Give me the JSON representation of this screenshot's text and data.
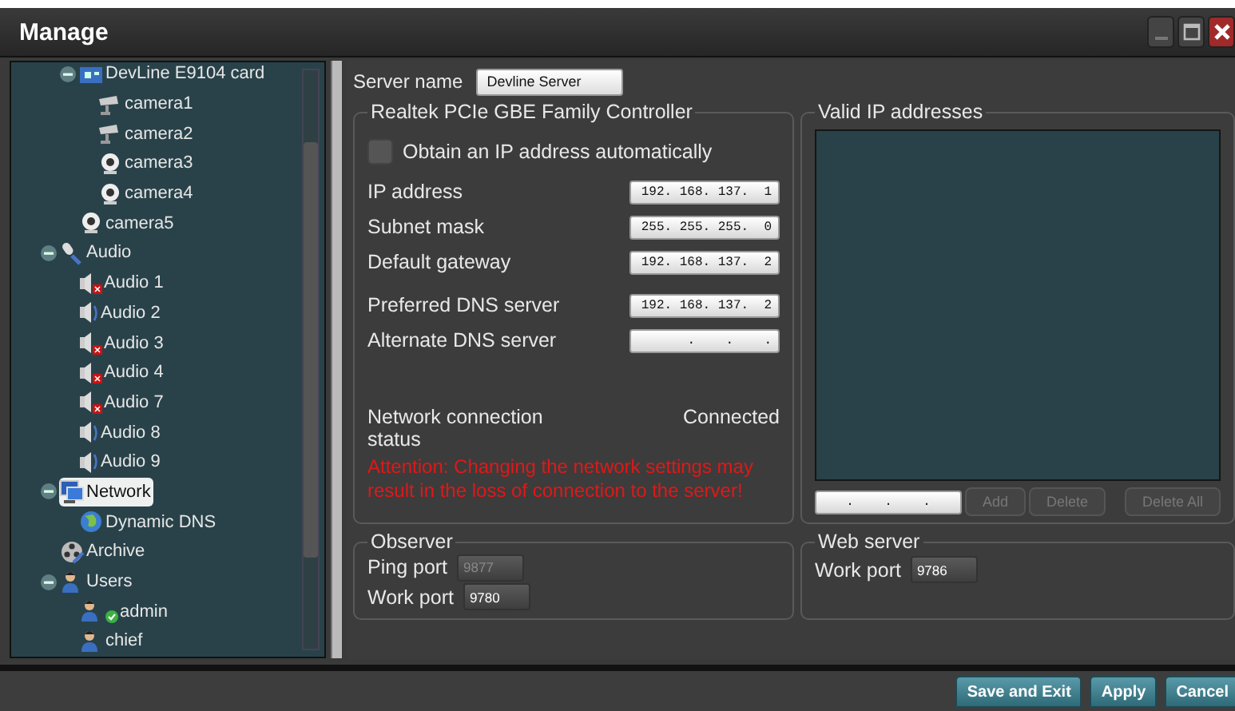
{
  "window": {
    "title": "Manage"
  },
  "tree": {
    "items": [
      {
        "children": [
          {
            "label": "DevLine E9104 card",
            "kind": "card",
            "expanded": true,
            "selected": false,
            "children": [
              {
                "label": "camera1",
                "kind": "cctv",
                "selected": false
              },
              {
                "label": "camera2",
                "kind": "cctv",
                "selected": false
              },
              {
                "label": "camera3",
                "kind": "webcam",
                "selected": false
              },
              {
                "label": "camera4",
                "kind": "webcam",
                "selected": false
              }
            ]
          },
          {
            "label": "camera5",
            "kind": "webcam",
            "selected": false
          }
        ]
      },
      {
        "label": "Audio",
        "kind": "microphone",
        "expanded": true,
        "selected": false,
        "children": [
          {
            "label": "Audio 1",
            "kind": "speaker",
            "error": true,
            "selected": false
          },
          {
            "label": "Audio 2",
            "kind": "speaker",
            "error": false,
            "selected": false
          },
          {
            "label": "Audio 3",
            "kind": "speaker",
            "error": true,
            "selected": false
          },
          {
            "label": "Audio 4",
            "kind": "speaker",
            "error": true,
            "selected": false
          },
          {
            "label": "Audio 7",
            "kind": "speaker",
            "error": true,
            "selected": false
          },
          {
            "label": "Audio 8",
            "kind": "speaker",
            "error": false,
            "selected": false
          },
          {
            "label": "Audio 9",
            "kind": "speaker",
            "error": false,
            "selected": false
          }
        ]
      },
      {
        "label": "Network",
        "kind": "network",
        "expanded": true,
        "selected": true,
        "children": [
          {
            "label": "Dynamic DNS",
            "kind": "globe",
            "selected": false
          }
        ]
      },
      {
        "label": "Archive",
        "kind": "archive",
        "selected": false
      },
      {
        "label": "Users",
        "kind": "users",
        "expanded": true,
        "selected": false,
        "children": [
          {
            "label": "admin",
            "kind": "user",
            "online": true,
            "selected": false
          },
          {
            "label": "chief",
            "kind": "user",
            "selected": false
          }
        ]
      }
    ]
  },
  "server_name": {
    "label": "Server name",
    "value": "Devline Server"
  },
  "adapter": {
    "title": "Realtek PCIe GBE Family Controller",
    "auto_ip": {
      "label": "Obtain an IP address automatically",
      "checked": false
    },
    "fields": [
      {
        "label": "IP address",
        "value": "192. 168. 137.  1"
      },
      {
        "label": "Subnet mask",
        "value": "255. 255. 255.  0"
      },
      {
        "label": "Default gateway",
        "value": "192. 168. 137.  2"
      }
    ],
    "dns_fields": [
      {
        "label": "Preferred DNS server",
        "value": "192. 168. 137.  2"
      },
      {
        "label": "Alternate DNS server",
        "value": ".    .    ."
      }
    ],
    "status": {
      "label": "Network connection status",
      "value": "Connected"
    },
    "warning": "Attention: Changing the network settings may result in the loss of connection to the server!"
  },
  "valid_ip": {
    "title": "Valid IP addresses",
    "input_value": ".    .    .",
    "buttons": [
      {
        "label": "Add",
        "disabled": true
      },
      {
        "label": "Delete",
        "disabled": true
      }
    ],
    "clear_button": {
      "label": "Delete All",
      "disabled": true
    }
  },
  "observer": {
    "title": "Observer",
    "ports": [
      {
        "label": "Ping port",
        "value": "9877",
        "disabled": true
      },
      {
        "label": "Work port",
        "value": "9780",
        "disabled": false
      }
    ]
  },
  "web_server": {
    "title": "Web server",
    "ports": [
      {
        "label": "Work port",
        "value": "9786",
        "disabled": false
      }
    ]
  },
  "footer_buttons": [
    "Save and Exit",
    "Apply",
    "Cancel"
  ]
}
